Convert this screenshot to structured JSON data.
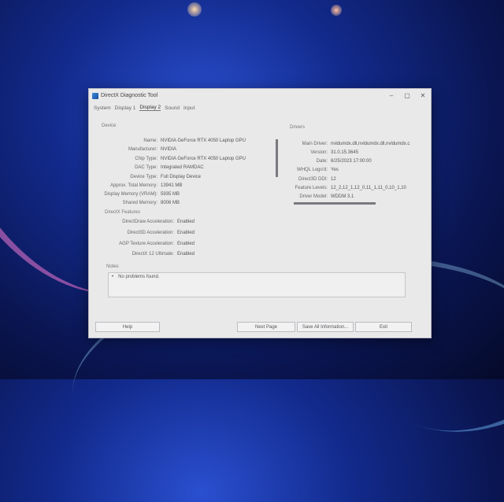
{
  "window": {
    "title": "DirectX Diagnostic Tool",
    "controls": {
      "minimize": "–",
      "maximize": "▢",
      "close": "✕"
    }
  },
  "tabs": [
    "System",
    "Display 1",
    "Display 2",
    "Sound",
    "Input"
  ],
  "active_tab": "Display 2",
  "device": {
    "heading": "Device",
    "rows": [
      {
        "label": "Name:",
        "value": "NVIDIA GeForce RTX 4050 Laptop GPU"
      },
      {
        "label": "Manufacturer:",
        "value": "NVIDIA"
      },
      {
        "label": "Chip Type:",
        "value": "NVIDIA GeForce RTX 4050 Laptop GPU"
      },
      {
        "label": "DAC Type:",
        "value": "Integrated RAMDAC"
      },
      {
        "label": "Device Type:",
        "value": "Full Display Device"
      },
      {
        "label": "Approx. Total Memory:",
        "value": "13941 MB"
      },
      {
        "label": "Display Memory (VRAM):",
        "value": "5935 MB"
      },
      {
        "label": "Shared Memory:",
        "value": "8006 MB"
      }
    ]
  },
  "drivers": {
    "heading": "Drivers",
    "rows": [
      {
        "label": "Main Driver:",
        "value": "nvldumdx.dll,nvldumdx.dll,nvldumdx.c"
      },
      {
        "label": "Version:",
        "value": "31.0.15.3645"
      },
      {
        "label": "Date:",
        "value": "6/25/2023 17:00:00"
      },
      {
        "label": "WHQL Logo'd:",
        "value": "Yes"
      },
      {
        "label": "Direct3D DDI:",
        "value": "12"
      },
      {
        "label": "Feature Levels:",
        "value": "12_2,12_1,12_0,11_1,11_0,10_1,10"
      },
      {
        "label": "Driver Model:",
        "value": "WDDM 3.1"
      }
    ]
  },
  "features": {
    "heading": "DirectX Features",
    "rows": [
      {
        "label": "DirectDraw Acceleration:",
        "value": "Enabled"
      },
      {
        "label": "Direct3D Acceleration:",
        "value": "Enabled"
      },
      {
        "label": "AGP Texture Acceleration:",
        "value": "Enabled"
      },
      {
        "label": "DirectX 12 Ultimate:",
        "value": "Enabled"
      }
    ]
  },
  "notes": {
    "heading": "Notes",
    "bullet": "•",
    "items": [
      "No problems found."
    ]
  },
  "buttons": {
    "help": "Help",
    "next_page": "Next Page",
    "save_all": "Save All Information...",
    "exit": "Exit"
  }
}
